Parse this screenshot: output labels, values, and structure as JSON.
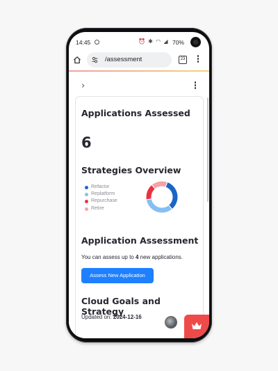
{
  "status_bar": {
    "time": "14:45",
    "battery": "70%"
  },
  "browser": {
    "url": "/assessment",
    "tab_count": "23"
  },
  "sections": {
    "assessed": {
      "title": "Applications Assessed",
      "count": "6"
    },
    "strategies": {
      "title": "Strategies Overview",
      "legend": [
        {
          "label": "Refactor",
          "color": "#1a66c7"
        },
        {
          "label": "Replatform",
          "color": "#86bff3"
        },
        {
          "label": "Repurchase",
          "color": "#e8333f"
        },
        {
          "label": "Retire",
          "color": "#f5a3a8"
        }
      ]
    },
    "assessment": {
      "title": "Application Assessment",
      "desc_prefix": "You can assess up to ",
      "desc_count": "4",
      "desc_suffix": " new applications.",
      "button_label": "Assess New Application"
    },
    "cloud_goals": {
      "title": "Cloud Goals and Strategy",
      "updated_label": "Updated on: ",
      "updated_date": "2024-12-16"
    }
  },
  "chart_data": {
    "type": "pie",
    "categories": [
      "Refactor",
      "Replatform",
      "Repurchase",
      "Retire"
    ],
    "values": [
      2,
      2,
      1,
      1
    ],
    "colors": [
      "#1a66c7",
      "#86bff3",
      "#e8333f",
      "#f5a3a8"
    ]
  }
}
